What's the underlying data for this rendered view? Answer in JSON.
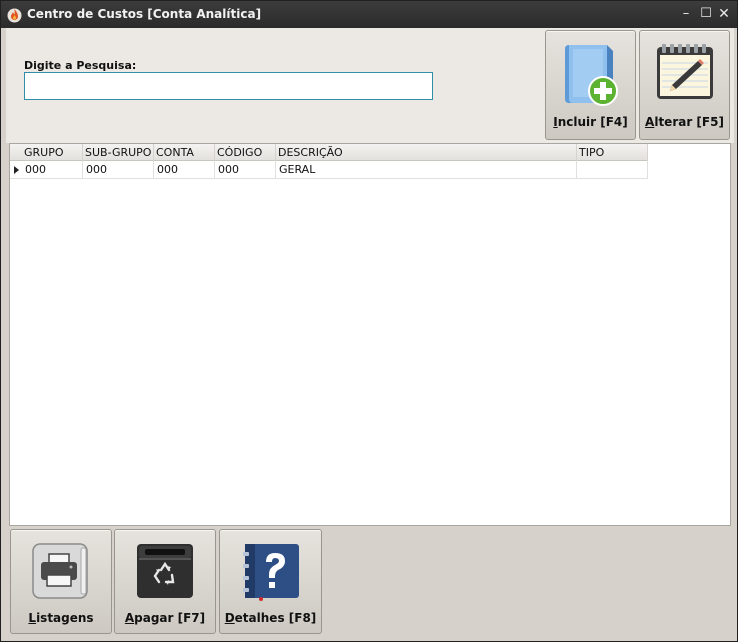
{
  "window": {
    "title": "Centro de Custos [Conta Analítica]",
    "controls": {
      "minimize": "–",
      "maximize": "☐",
      "close": "✕"
    }
  },
  "search": {
    "label": "Digite a Pesquisa:",
    "value": "",
    "placeholder": ""
  },
  "actions": {
    "incluir": {
      "underline": "I",
      "rest": "ncluir [F4]",
      "icon": "add-document-icon"
    },
    "alterar": {
      "underline": "A",
      "rest": "lterar [F5]",
      "icon": "notepad-pencil-icon"
    }
  },
  "grid": {
    "columns": [
      "GRUPO",
      "SUB-GRUPO",
      "CONTA",
      "CÓDIGO",
      "DESCRIÇÃO",
      "TIPO"
    ],
    "rows": [
      [
        "000",
        "000",
        "000",
        "000",
        "GERAL",
        ""
      ]
    ]
  },
  "bottom_actions": {
    "listagens": {
      "underline": "L",
      "rest": "istagens",
      "icon": "printer-icon"
    },
    "apagar": {
      "underline": "A",
      "rest": "pagar [F7]",
      "icon": "recycle-bin-icon"
    },
    "detalhes": {
      "underline": "D",
      "rest": "etalhes [F8]",
      "icon": "help-book-icon"
    }
  },
  "colors": {
    "titlebar": "#2f2f2f",
    "window_bg": "#d6d2cb",
    "panel_bg": "#ece9e4",
    "input_border": "#2f8fa6"
  }
}
